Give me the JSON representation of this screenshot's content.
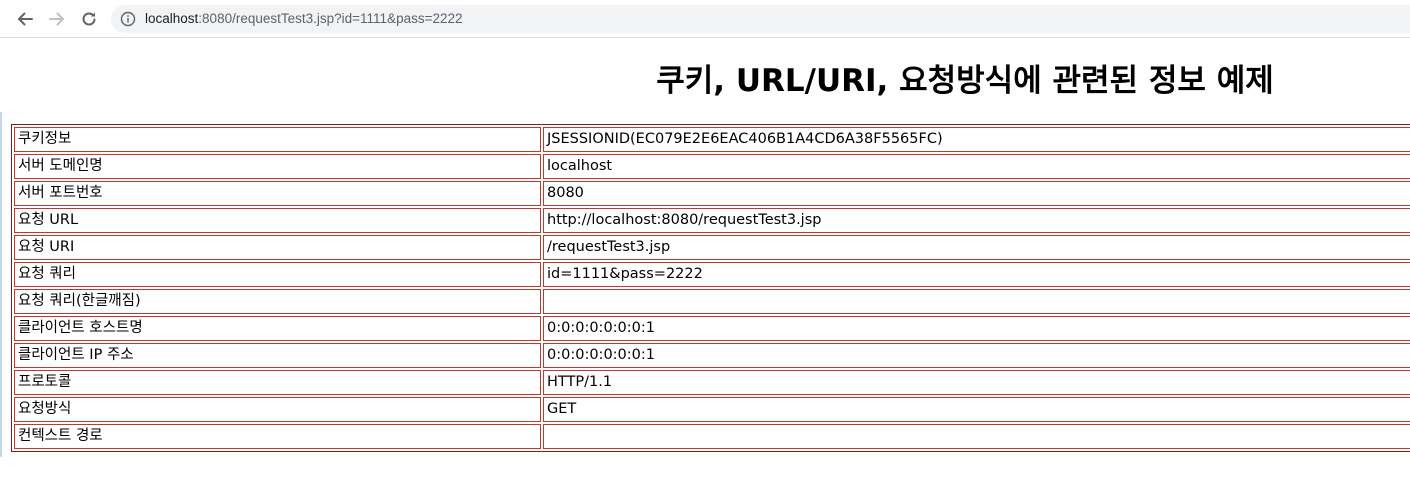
{
  "browser": {
    "address": {
      "host": "localhost",
      "rest": ":8080/requestTest3.jsp?id=1111&pass=2222"
    }
  },
  "page": {
    "title": "쿠키, URL/URI, 요청방식에 관련된 정보 예제",
    "rows": [
      {
        "label": "쿠키정보",
        "value": "JSESSIONID(EC079E2E6EAC406B1A4CD6A38F5565FC)"
      },
      {
        "label": "서버 도메인명",
        "value": "localhost"
      },
      {
        "label": "서버 포트번호",
        "value": "8080"
      },
      {
        "label": "요청 URL",
        "value": "http://localhost:8080/requestTest3.jsp"
      },
      {
        "label": "요청 URI",
        "value": "/requestTest3.jsp"
      },
      {
        "label": "요청 쿼리",
        "value": "id=1111&pass=2222"
      },
      {
        "label": "요청 쿼리(한글깨짐)",
        "value": ""
      },
      {
        "label": "클라이언트 호스트명",
        "value": "0:0:0:0:0:0:0:1"
      },
      {
        "label": "클라이언트 IP 주소",
        "value": "0:0:0:0:0:0:0:1"
      },
      {
        "label": "프로토콜",
        "value": "HTTP/1.1"
      },
      {
        "label": "요청방식",
        "value": "GET"
      },
      {
        "label": "컨텍스트 경로",
        "value": ""
      }
    ]
  }
}
